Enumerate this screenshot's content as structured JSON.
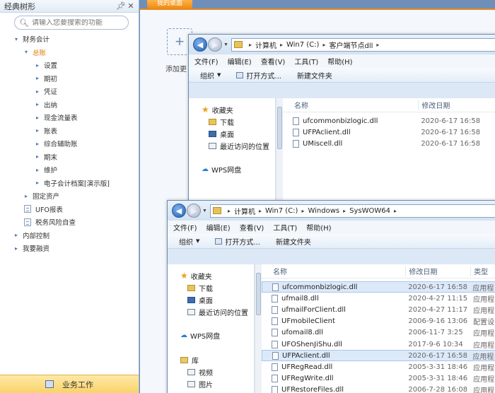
{
  "tree_panel": {
    "title": "经典树形",
    "pin_icon": "pin-icon",
    "close_icon": "close-icon",
    "search_placeholder": "请输入您要搜索的功能",
    "items": [
      {
        "label": "财务会计",
        "level": 0,
        "kind": "expanded"
      },
      {
        "label": "总账",
        "level": 1,
        "kind": "expanded",
        "active": true
      },
      {
        "label": "设置",
        "level": 2,
        "kind": "collapsed"
      },
      {
        "label": "期初",
        "level": 2,
        "kind": "collapsed"
      },
      {
        "label": "凭证",
        "level": 2,
        "kind": "collapsed"
      },
      {
        "label": "出纳",
        "level": 2,
        "kind": "collapsed"
      },
      {
        "label": "现金流量表",
        "level": 2,
        "kind": "collapsed"
      },
      {
        "label": "账表",
        "level": 2,
        "kind": "collapsed"
      },
      {
        "label": "综合辅助账",
        "level": 2,
        "kind": "collapsed"
      },
      {
        "label": "期末",
        "level": 2,
        "kind": "collapsed"
      },
      {
        "label": "维护",
        "level": 2,
        "kind": "collapsed"
      },
      {
        "label": "电子会计档案[演示版]",
        "level": 2,
        "kind": "collapsed"
      },
      {
        "label": "固定资产",
        "level": 1,
        "kind": "collapsed"
      },
      {
        "label": "UFO报表",
        "level": 1,
        "kind": "doc"
      },
      {
        "label": "税务风险自查",
        "level": 1,
        "kind": "doc"
      },
      {
        "label": "内部控制",
        "level": 0,
        "kind": "collapsed"
      },
      {
        "label": "我要融资",
        "level": 0,
        "kind": "collapsed"
      }
    ],
    "footer_label": "业务工作"
  },
  "workspace": {
    "tab_label": "我的桌面",
    "add_icon": "plus-icon",
    "add_label": "添加更"
  },
  "window1": {
    "crumbs": [
      "计算机",
      "Win7 (C:)",
      "客户端节点dll"
    ],
    "menu": [
      "文件(F)",
      "编辑(E)",
      "查看(V)",
      "工具(T)",
      "帮助(H)"
    ],
    "commands": [
      "组织",
      "打开方式...",
      "新建文件夹"
    ],
    "nav": [
      "收藏夹",
      "下载",
      "桌面",
      "最近访问的位置",
      "WPS网盘"
    ],
    "columns": [
      "名称",
      "修改日期"
    ],
    "files": [
      {
        "name": "ufcommonbizlogic.dll",
        "date": "2020-6-17 16:58"
      },
      {
        "name": "UFPAclient.dll",
        "date": "2020-6-17 16:58"
      },
      {
        "name": "UMiscell.dll",
        "date": "2020-6-17 16:58"
      }
    ]
  },
  "window2": {
    "crumbs": [
      "计算机",
      "Win7 (C:)",
      "Windows",
      "SysWOW64"
    ],
    "menu": [
      "文件(F)",
      "编辑(E)",
      "查看(V)",
      "工具(T)",
      "帮助(H)"
    ],
    "commands": [
      "组织",
      "打开方式...",
      "新建文件夹"
    ],
    "nav": [
      "收藏夹",
      "下载",
      "桌面",
      "最近访问的位置",
      "WPS网盘",
      "库",
      "视频",
      "图片"
    ],
    "columns": [
      "名称",
      "修改日期",
      "类型"
    ],
    "files": [
      {
        "name": "ufcommonbizlogic.dll",
        "date": "2020-6-17 16:58",
        "type": "应用程",
        "sel": true
      },
      {
        "name": "ufmail8.dll",
        "date": "2020-4-27 11:15",
        "type": "应用程"
      },
      {
        "name": "ufmailForClient.dll",
        "date": "2020-4-27 11:17",
        "type": "应用程"
      },
      {
        "name": "UFmobileClient",
        "date": "2006-9-16 13:06",
        "type": "配置设"
      },
      {
        "name": "ufomail8.dll",
        "date": "2006-11-7 3:25",
        "type": "应用程"
      },
      {
        "name": "UFOShenJiShu.dll",
        "date": "2017-9-6 10:34",
        "type": "应用程"
      },
      {
        "name": "UFPAclient.dll",
        "date": "2020-6-17 16:58",
        "type": "应用程",
        "sel": true
      },
      {
        "name": "UFRegRead.dll",
        "date": "2005-3-31 18:46",
        "type": "应用程"
      },
      {
        "name": "UFRegWrite.dll",
        "date": "2005-3-31 18:46",
        "type": "应用程"
      },
      {
        "name": "UFRestoreFiles.dll",
        "date": "2006-7-28 16:08",
        "type": "应用程"
      }
    ]
  }
}
